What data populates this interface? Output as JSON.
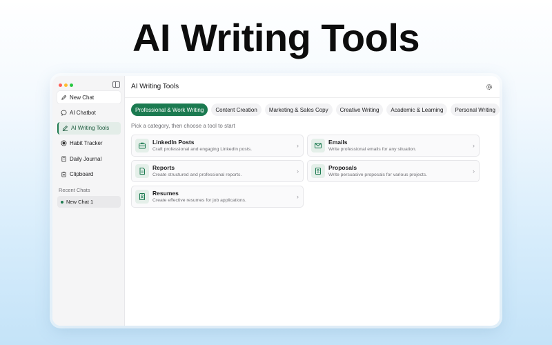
{
  "hero": {
    "title": "AI Writing Tools"
  },
  "sidebar": {
    "items": [
      {
        "label": "New Chat",
        "icon": "pencil-icon"
      },
      {
        "label": "AI Chatbot",
        "icon": "chat-bubble-icon"
      },
      {
        "label": "AI Writing Tools",
        "icon": "pen-icon"
      },
      {
        "label": "Habit Tracker",
        "icon": "target-icon"
      },
      {
        "label": "Daily Journal",
        "icon": "book-icon"
      },
      {
        "label": "Clipboard",
        "icon": "clipboard-icon"
      }
    ],
    "active_index": 2,
    "recent_label": "Recent Chats",
    "recent_items": [
      {
        "label": "New Chat 1"
      }
    ]
  },
  "main": {
    "title": "AI Writing Tools",
    "tabs": [
      {
        "label": "Professional & Work Writing"
      },
      {
        "label": "Content Creation"
      },
      {
        "label": "Marketing & Sales Copy"
      },
      {
        "label": "Creative Writing"
      },
      {
        "label": "Academic & Learning"
      },
      {
        "label": "Personal Writing"
      }
    ],
    "active_tab": 0,
    "hint": "Pick a category, then choose a tool to start",
    "tools": [
      {
        "title": "LinkedIn Posts",
        "desc": "Craft professional and engaging LinkedIn posts.",
        "icon": "briefcase-icon"
      },
      {
        "title": "Emails",
        "desc": "Write professional emails for any situation.",
        "icon": "envelope-icon"
      },
      {
        "title": "Reports",
        "desc": "Create structured and professional reports.",
        "icon": "document-icon"
      },
      {
        "title": "Proposals",
        "desc": "Write persuasive proposals for various projects.",
        "icon": "proposal-icon"
      },
      {
        "title": "Resumes",
        "desc": "Create effective resumes for job applications.",
        "icon": "resume-icon"
      }
    ]
  },
  "colors": {
    "accent": "#1b7a50",
    "accent_bg": "#e4efe9",
    "sidebar_bg": "#f5f5f6"
  }
}
